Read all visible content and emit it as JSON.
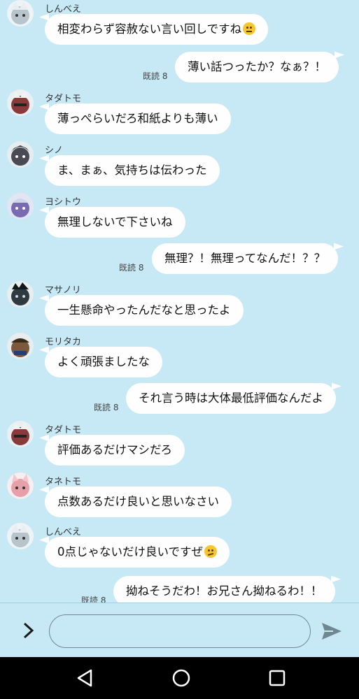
{
  "messages": [
    {
      "type": "in",
      "sender": "しんべえ",
      "text": "相変わらず容赦ない言い回しですね",
      "emoji": "expressionless-face",
      "avatar_color": "#b8c4cc"
    },
    {
      "type": "out",
      "text": "薄い話つったか？なぁ？！",
      "read": "既読 8"
    },
    {
      "type": "in",
      "sender": "タダトモ",
      "text": "薄っぺらいだろ和紙よりも薄い",
      "avatar_color": "#8a3a3a"
    },
    {
      "type": "in",
      "sender": "シノ",
      "text": "ま、まぁ、気持ちは伝わった",
      "avatar_color": "#4a4a55"
    },
    {
      "type": "in",
      "sender": "ヨシトウ",
      "text": "無理しないで下さいね",
      "avatar_color": "#7a6ab0"
    },
    {
      "type": "out",
      "text": "無理？！無理ってなんだ！？？",
      "read": "既読 8"
    },
    {
      "type": "in",
      "sender": "マサノリ",
      "text": "一生懸命やったんだなと思ったよ",
      "avatar_color": "#2f3a40"
    },
    {
      "type": "in",
      "sender": "モリタカ",
      "text": "よく頑張ましたな",
      "avatar_color": "#7a5a3a"
    },
    {
      "type": "out",
      "text": "それ言う時は大体最低評価なんだよ",
      "read": "既読 8"
    },
    {
      "type": "in",
      "sender": "タダトモ",
      "text": "評価あるだけマシだろ",
      "avatar_color": "#8a3a3a"
    },
    {
      "type": "in",
      "sender": "タネトモ",
      "text": "点数あるだけ良いと思いなさい",
      "avatar_color": "#e8a0a8"
    },
    {
      "type": "in",
      "sender": "しんべえ",
      "text": "0点じゃないだけ良いですぜ",
      "emoji": "confused-face",
      "avatar_color": "#b8c4cc"
    },
    {
      "type": "out",
      "text": "拗ねそうだわ！お兄さん拗ねるわ！！",
      "read": "既読 8"
    }
  ],
  "input": {
    "placeholder": "",
    "value": ""
  },
  "colors": {
    "background": "#c6e9f5",
    "bubble": "#fefefe",
    "send": "#6f8791"
  }
}
